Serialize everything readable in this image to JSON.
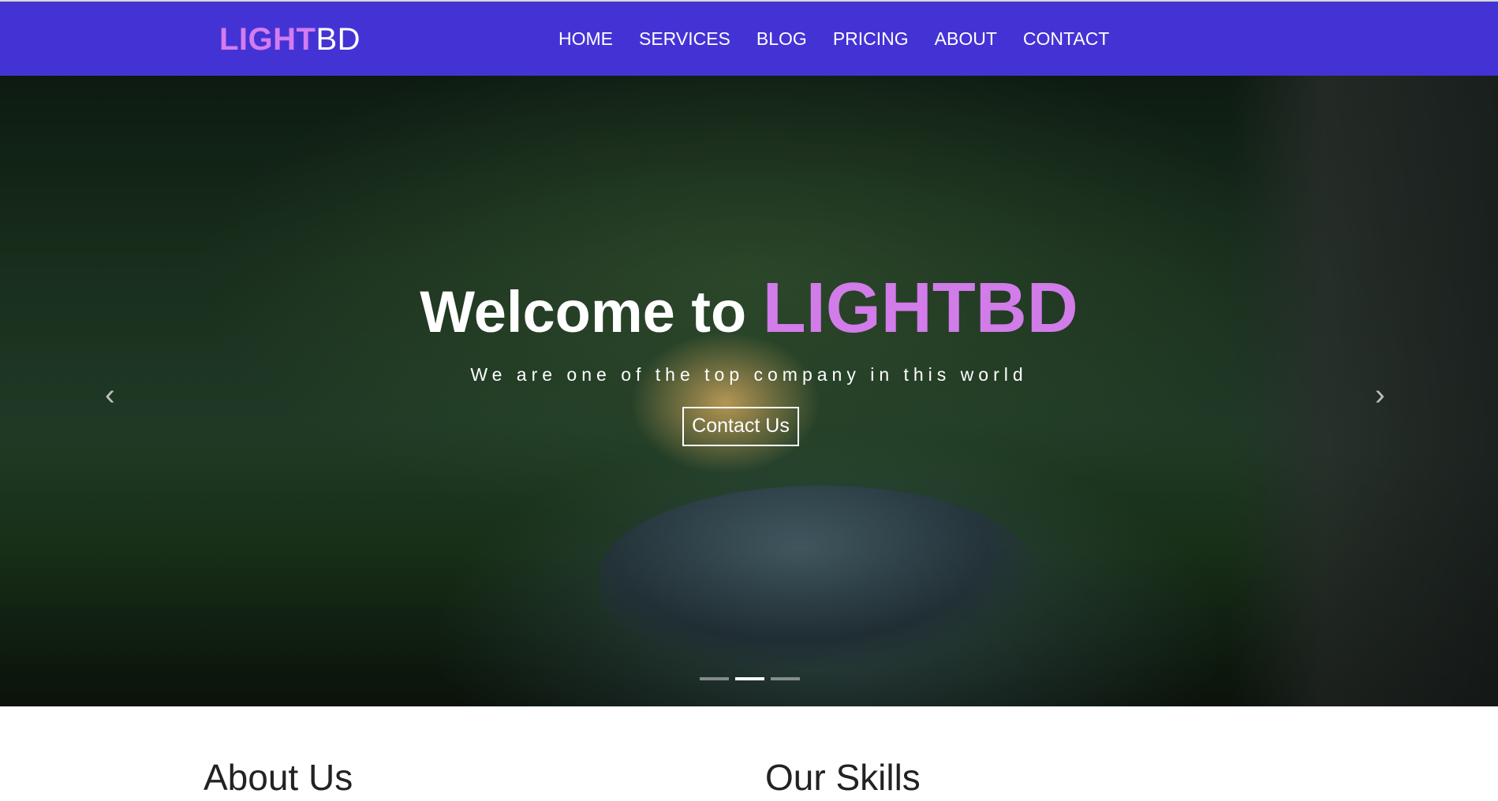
{
  "brand": {
    "part1": "LIGHT",
    "part2": "BD"
  },
  "nav": {
    "items": [
      "HOME",
      "SERVICES",
      "BLOG",
      "PRICING",
      "ABOUT",
      "CONTACT"
    ]
  },
  "hero": {
    "title_prefix": "Welcome to",
    "title_accent": "LIGHTBD",
    "subtitle": "We are one of the top company in this world",
    "button": "Contact Us",
    "prev_icon": "chevron-left-icon",
    "next_icon": "chevron-right-icon",
    "slides": 3,
    "active_slide": 2
  },
  "sections": {
    "about_title": "About Us",
    "skills_title": "Our Skills"
  },
  "colors": {
    "navbar": "#4433d4",
    "accent": "#d37cf0"
  }
}
